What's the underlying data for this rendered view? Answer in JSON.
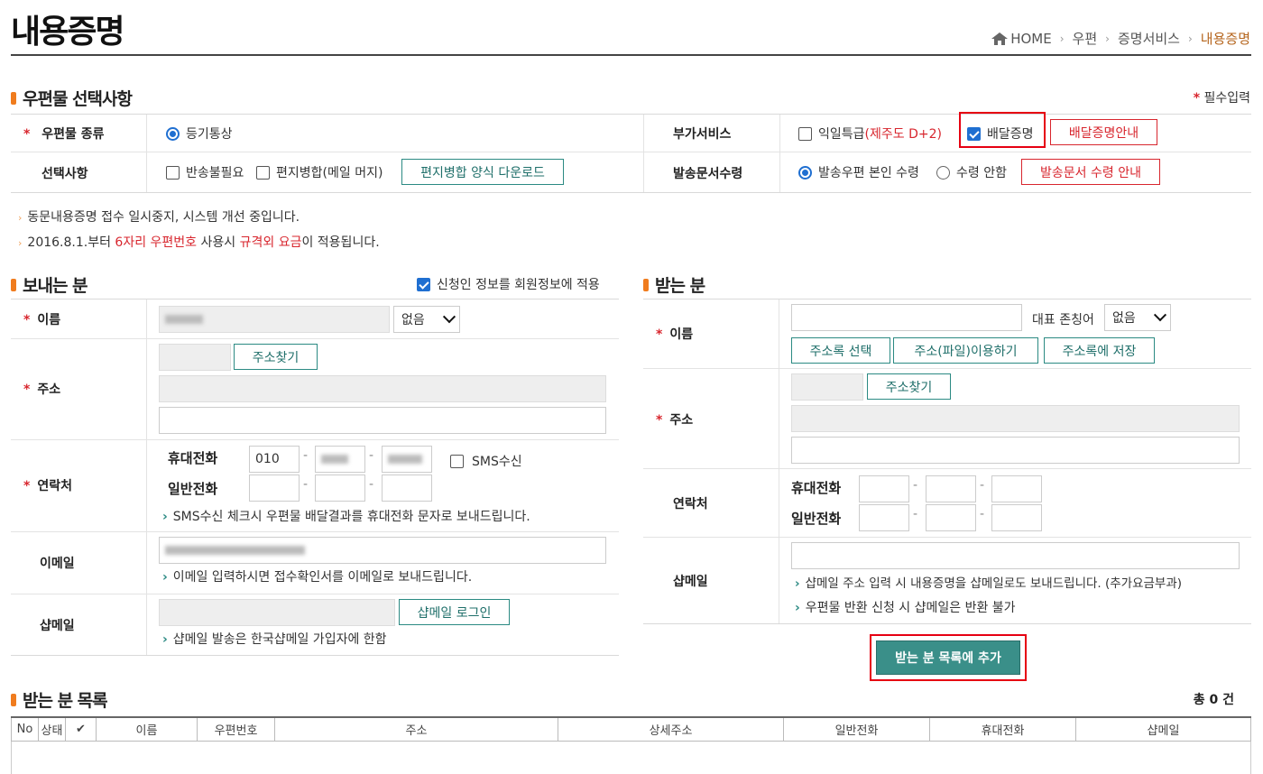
{
  "page": {
    "title": "내용증명",
    "breadcrumb": [
      "HOME",
      "우편",
      "증명서비스",
      "내용증명"
    ]
  },
  "postal": {
    "section_title": "우편물 선택사항",
    "required_note": "필수입력",
    "type_label": "우편물 종류",
    "type_value": "등기통상",
    "addon_label": "부가서비스",
    "addon_nextday": "익일특급",
    "addon_nextday_note": "(제주도 D+2)",
    "addon_delivery_proof": "배달증명",
    "delivery_guide_btn": "배달증명안내",
    "options_label": "선택사항",
    "opt_no_return": "반송불필요",
    "opt_merge": "편지병합(메일 머지)",
    "merge_download_btn": "편지병합 양식 다운로드",
    "docs_label": "발송문서수령",
    "docs_self": "발송우편 본인 수령",
    "docs_none": "수령 안함",
    "docs_guide_btn": "발송문서 수령 안내"
  },
  "notices": {
    "line1": "동문내용증명 접수 일시중지, 시스템 개선 중입니다.",
    "line2_prefix": "2016.8.1.부터 ",
    "line2_red1": "6자리 우편번호",
    "line2_mid": " 사용시 ",
    "line2_red2": "규격외 요금",
    "line2_suffix": "이 적용됩니다."
  },
  "sender": {
    "section_title": "보내는 분",
    "apply_member": "신청인 정보를 회원정보에 적용",
    "name_label": "이름",
    "honorific": "없음",
    "address_label": "주소",
    "find_address_btn": "주소찾기",
    "contact_label": "연락처",
    "mobile_label": "휴대전화",
    "mobile_prefix": "010",
    "phone_label": "일반전화",
    "sms_label": "SMS수신",
    "sms_note": "SMS수신 체크시 우편물 배달결과를 휴대전화 문자로 보내드립니다.",
    "email_label": "이메일",
    "email_note": "이메일 입력하시면 접수확인서를 이메일로 보내드립니다.",
    "shopmail_label": "샵메일",
    "shopmail_login_btn": "샵메일 로그인",
    "shopmail_note": "샵메일 발송은 한국샵메일 가입자에 한함"
  },
  "receiver": {
    "section_title": "받는 분",
    "name_label": "이름",
    "honorific_label": "대표 존칭어",
    "honorific": "없음",
    "addrbook_select_btn": "주소록 선택",
    "addrfile_btn": "주소(파일)이용하기",
    "addrbook_save_btn": "주소록에 저장",
    "address_label": "주소",
    "find_address_btn": "주소찾기",
    "contact_label": "연락처",
    "mobile_label": "휴대전화",
    "phone_label": "일반전화",
    "shopmail_label": "샵메일",
    "shopmail_note1": "샵메일 주소 입력 시 내용증명을 샵메일로도 보내드립니다. (추가요금부과)",
    "shopmail_note2": "우편물 반환 신청 시 샵메일은 반환 불가",
    "add_btn": "받는 분 목록에 추가"
  },
  "list": {
    "section_title": "받는 분 목록",
    "total": "총 0 건",
    "columns": [
      "No",
      "상태",
      "✔",
      "이름",
      "우편번호",
      "주소",
      "상세주소",
      "일반전화",
      "휴대전화",
      "샵메일"
    ]
  }
}
